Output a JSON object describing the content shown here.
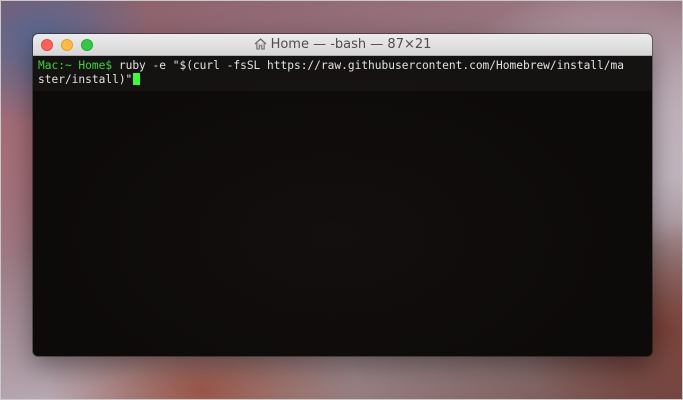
{
  "window": {
    "title": "Home — -bash — 87×21",
    "title_icon": "home-icon"
  },
  "terminal": {
    "prompt": "Mac:~ Home$",
    "command_line_1": "ruby -e \"$(curl -fsSL https://raw.githubusercontent.com/Homebrew/install/ma",
    "command_line_2": "ster/install)\""
  },
  "colors": {
    "prompt": "#3dd43a",
    "cursor": "#39ff3a",
    "terminal_background": "#0f0b0b"
  }
}
